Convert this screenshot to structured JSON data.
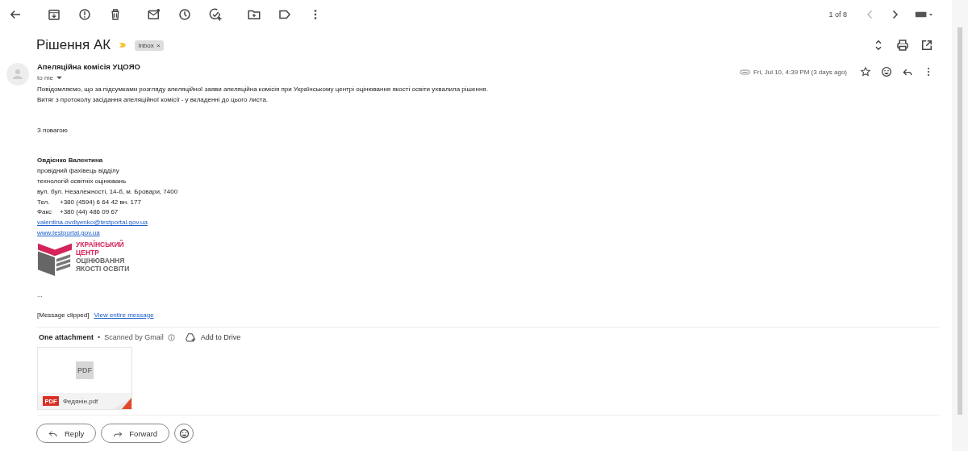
{
  "toolbar": {
    "pager": "1 of 8"
  },
  "subject": "Рішення АК",
  "label": {
    "text": "Inbox",
    "close": "×"
  },
  "message": {
    "sender": "Апеляційна комісія УЦОЯО",
    "recipient": "to me",
    "date": "Fri, Jul 10, 4:39 PM (3 days ago)",
    "body": [
      "Повідомляємо, що за підсумками розгляду апеляційної заяви апеляційна комісія при Українському центрі оцінювання якості освіти ухвалила рішення.",
      "Витяг з протоколу засідання апеляційної комісії - у вкладенні до цього листа."
    ],
    "closing": "З повагою",
    "signature_name": "Овдієнко Валентина",
    "signature_lines": [
      "провідний фахівець відділу",
      "технологій освітніх оцінювань",
      "вул. бул. Незалежності, 14-б, м. Бровари, 7400"
    ],
    "phones": [
      {
        "label": "Тел.",
        "value": "+380 (4594) 6 64 42 вн. 177"
      },
      {
        "label": "Факс",
        "value": "+380 (44) 486 09 67"
      }
    ],
    "links": [
      "valentina.ovdiyenko@testportal.gov.ua",
      "www.testportal.gov.ua"
    ],
    "logo_lines": [
      "УКРАЇНСЬКИЙ",
      "ЦЕНТР",
      "ОЦІНЮВАННЯ",
      "ЯКОСТІ ОСВІТИ"
    ],
    "ellipsis": "...",
    "clipped": "[Message clipped]",
    "view_entire": "View entire message"
  },
  "attachments": {
    "title": "One attachment",
    "dot": "•",
    "scanned": "Scanned by Gmail",
    "add_to_drive": "Add to Drive",
    "files": [
      {
        "name": "Федянін.pdf",
        "thumb_label": "PDF",
        "icon_label": "PDF"
      }
    ]
  },
  "actions": [
    "Reply",
    "Forward"
  ]
}
